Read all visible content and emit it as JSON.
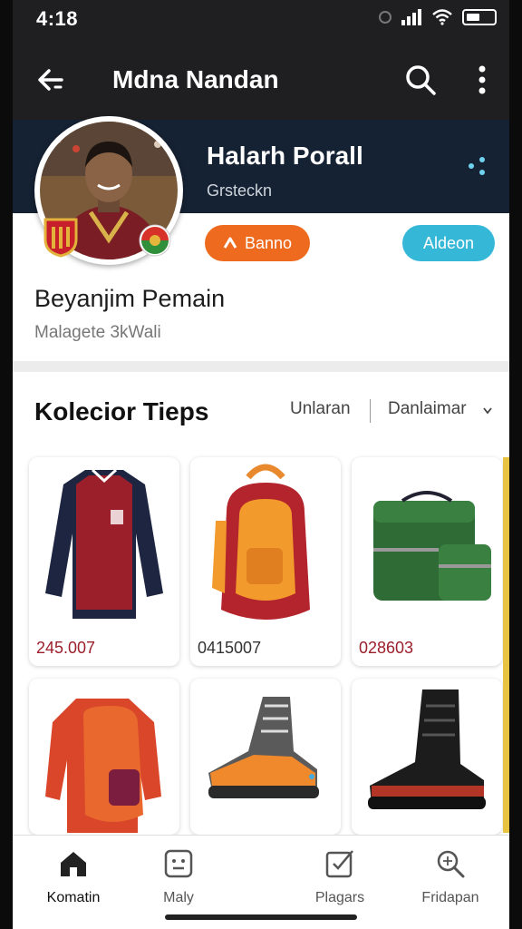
{
  "status": {
    "time": "4:18"
  },
  "header": {
    "title": "Mdna Nandan",
    "back_icon": "back-arrow-icon",
    "search_icon": "search-icon",
    "more_icon": "more-vertical-icon"
  },
  "profile": {
    "name": "Halarh Porall",
    "subtitle": "Grsteckn",
    "share_icon": "share-icon"
  },
  "actions": {
    "primary_label": "Banno",
    "primary_icon": "chevron-up-icon",
    "secondary_label": "Aldeon",
    "primary_color": "#ee6a1f",
    "secondary_color": "#35b7d8"
  },
  "section": {
    "title": "Beyanjim Pemain",
    "subtitle": "Malagete  3kWali"
  },
  "collection": {
    "title": "Kolecior Tieps",
    "filter1": "Unlaran",
    "filter2": "Danlaimar"
  },
  "products": [
    {
      "price": "245.007",
      "icon": "jacket-image"
    },
    {
      "price": "0415007",
      "icon": "backpack-image"
    },
    {
      "price": "028603",
      "icon": "green-bag-image"
    },
    {
      "price": "",
      "icon": "red-backpack-image"
    },
    {
      "price": "",
      "icon": "sneaker-image"
    },
    {
      "price": "",
      "icon": "black-boot-image"
    }
  ],
  "nav": [
    {
      "label": "Komatin",
      "icon": "home-icon",
      "active": true
    },
    {
      "label": "Maly",
      "icon": "grid-face-icon"
    },
    {
      "label": "Plagars",
      "icon": "checklist-icon"
    },
    {
      "label": "Fridapan",
      "icon": "search-icon"
    }
  ]
}
